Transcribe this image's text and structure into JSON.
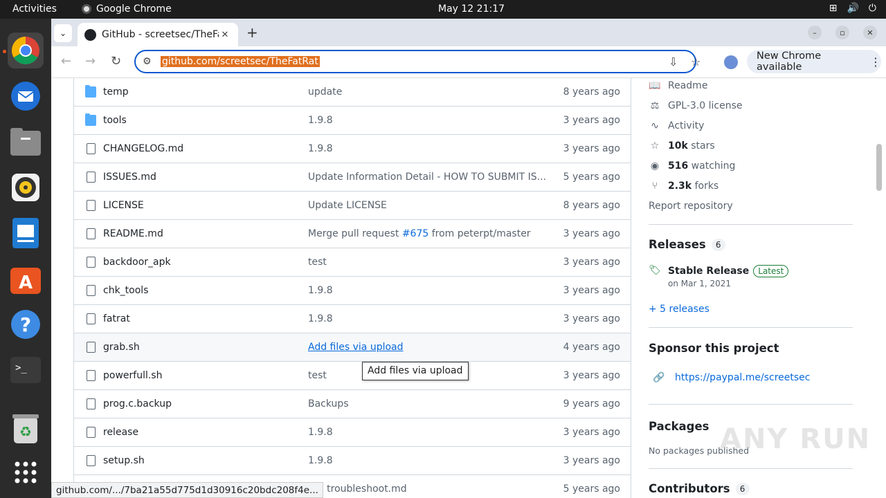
{
  "topbar": {
    "activities": "Activities",
    "app": "Google Chrome",
    "clock": "May 12  21:17"
  },
  "dock": [
    "chrome-icon",
    "thunderbird-icon",
    "files-icon",
    "rhythmbox-icon",
    "writer-icon",
    "software-center-icon",
    "help-icon",
    "terminal-icon",
    "trash-icon",
    "app-grid-icon"
  ],
  "browser": {
    "tab_title": "GitHub - screetsec/TheFatRat",
    "url": "github.com/screetsec/TheFatRat",
    "new_chrome": "New Chrome available"
  },
  "files": [
    {
      "name": "temp",
      "type": "folder",
      "message": "update",
      "age": "8 years ago"
    },
    {
      "name": "tools",
      "type": "folder",
      "message": "1.9.8",
      "age": "3 years ago"
    },
    {
      "name": "CHANGELOG.md",
      "type": "file",
      "message": "1.9.8",
      "age": "3 years ago"
    },
    {
      "name": "ISSUES.md",
      "type": "file",
      "message": "Update Information Detail - HOW TO SUBMIT IS...",
      "age": "5 years ago"
    },
    {
      "name": "LICENSE",
      "type": "file",
      "message": "Update LICENSE",
      "age": "8 years ago"
    },
    {
      "name": "README.md",
      "type": "file",
      "message_pre": "Merge pull request ",
      "message_link": "#675",
      "message_post": " from peterpt/master",
      "age": "3 years ago"
    },
    {
      "name": "backdoor_apk",
      "type": "file",
      "message": "test",
      "age": "3 years ago"
    },
    {
      "name": "chk_tools",
      "type": "file",
      "message": "1.9.8",
      "age": "3 years ago"
    },
    {
      "name": "fatrat",
      "type": "file",
      "message": "1.9.8",
      "age": "3 years ago"
    },
    {
      "name": "grab.sh",
      "type": "file",
      "message": "Add files via upload",
      "age": "4 years ago"
    },
    {
      "name": "powerfull.sh",
      "type": "file",
      "message": "test",
      "age": "3 years ago"
    },
    {
      "name": "prog.c.backup",
      "type": "file",
      "message": "Backups",
      "age": "9 years ago"
    },
    {
      "name": "release",
      "type": "file",
      "message": "1.9.8",
      "age": "3 years ago"
    },
    {
      "name": "setup.sh",
      "type": "file",
      "message": "1.9.8",
      "age": "3 years ago"
    },
    {
      "name": "",
      "type": "file",
      "message": "ate troubleshoot.md",
      "age": "5 years ago"
    }
  ],
  "tooltip": "Add files via upload",
  "status_url": "github.com/.../7ba21a55d775d1d30916c20bdc208f4e...",
  "sidebar": {
    "readme": "Readme",
    "license": "GPL-3.0 license",
    "activity": "Activity",
    "stars_count": "10k",
    "stars_label": " stars",
    "watching_count": "516",
    "watching_label": " watching",
    "forks_count": "2.3k",
    "forks_label": " forks",
    "report": "Report repository",
    "releases_title": "Releases",
    "releases_count": "6",
    "release_name": "Stable Release",
    "release_badge": "Latest",
    "release_date": "on Mar 1, 2021",
    "more_releases": "+ 5 releases",
    "sponsor_title": "Sponsor this project",
    "sponsor_link": "https://paypal.me/screetsec",
    "packages_title": "Packages",
    "packages_text": "No packages published",
    "contributors_title": "Contributors",
    "contributors_count": "6"
  },
  "watermark": "ANY RUN"
}
